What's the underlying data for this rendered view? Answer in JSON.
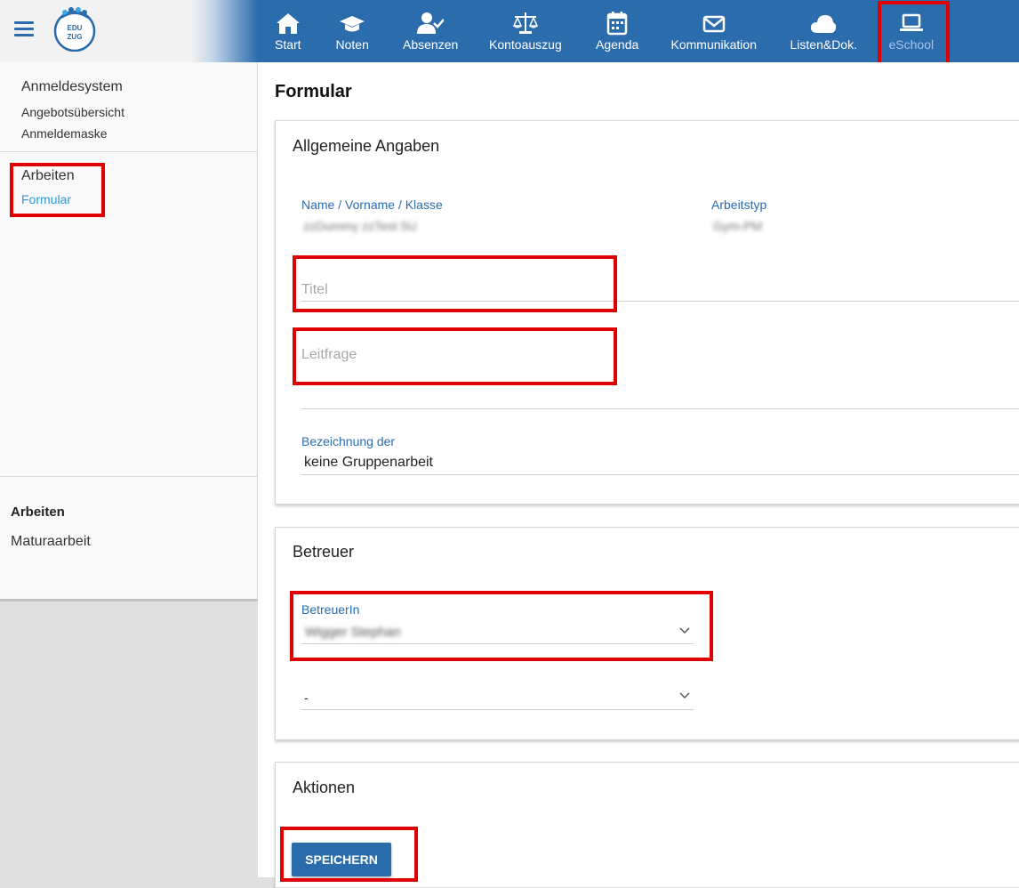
{
  "app": {
    "logo_text_top": "EDU",
    "logo_text_bottom": "ZUG"
  },
  "nav": {
    "items": [
      {
        "label": "Start",
        "icon": "home-icon"
      },
      {
        "label": "Noten",
        "icon": "graduation-cap-icon"
      },
      {
        "label": "Absenzen",
        "icon": "user-check-icon"
      },
      {
        "label": "Kontoauszug",
        "icon": "balance-scale-icon"
      },
      {
        "label": "Agenda",
        "icon": "calendar-icon"
      },
      {
        "label": "Kommunikation",
        "icon": "envelope-icon"
      },
      {
        "label": "Listen&Dok.",
        "icon": "cloud-icon"
      },
      {
        "label": "eSchool",
        "icon": "laptop-icon",
        "active": true
      }
    ]
  },
  "sidebar": {
    "section1": {
      "heading": "Anmeldesystem",
      "items": [
        "Angebotsübersicht",
        "Anmeldemaske"
      ]
    },
    "section2": {
      "heading": "Arbeiten",
      "active_item": "Formular"
    },
    "section3": {
      "heading": "Arbeiten",
      "item": "Maturaarbeit"
    }
  },
  "main": {
    "page_title": "Formular",
    "general": {
      "title": "Allgemeine Angaben",
      "name_label": "Name / Vorname / Klasse",
      "name_value": "zzDummy zzTest 5U",
      "type_label": "Arbeitstyp",
      "type_value": "Gym-PM",
      "titel_placeholder": "Titel",
      "leitfrage_placeholder": "Leitfrage",
      "bezeichnung_label": "Bezeichnung der",
      "bezeichnung_value": "keine Gruppenarbeit"
    },
    "betreuer": {
      "title": "Betreuer",
      "select_label": "BetreuerIn",
      "select_value": "Wigger Stephan",
      "second_select_value": "-"
    },
    "actions": {
      "title": "Aktionen",
      "save_label": "SPEICHERN"
    }
  },
  "colors": {
    "primary": "#2b6cad",
    "highlight": "#e00000",
    "accent_link": "#2b9bd8"
  }
}
